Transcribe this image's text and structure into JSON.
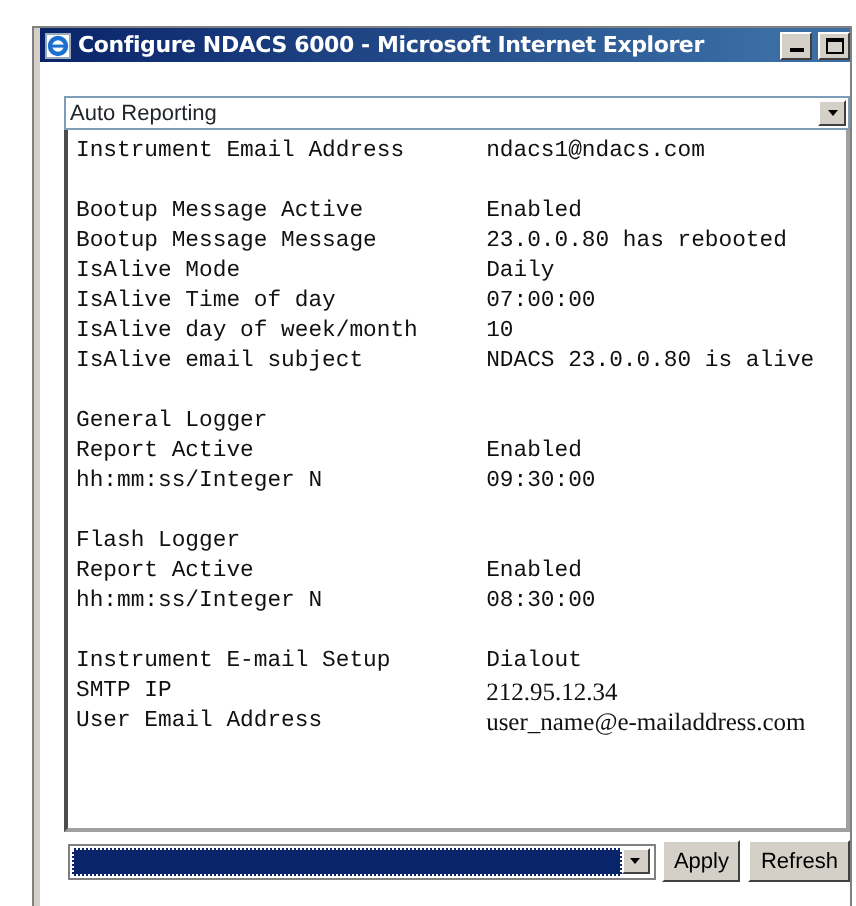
{
  "window": {
    "title": "Configure NDACS 6000 - Microsoft Internet Explorer"
  },
  "section_select": {
    "value": "Auto Reporting"
  },
  "sections": [
    {
      "rows": [
        {
          "kind": "pair",
          "label": "Instrument Email Address",
          "value": "ndacs1@ndacs.com"
        }
      ]
    },
    {
      "rows": [
        {
          "kind": "pair",
          "label": "Bootup Message Active",
          "value": "Enabled"
        },
        {
          "kind": "pair",
          "label": "Bootup Message Message",
          "value": "23.0.0.80 has rebooted"
        },
        {
          "kind": "pair",
          "label": "IsAlive Mode",
          "value": "Daily"
        },
        {
          "kind": "pair",
          "label": "IsAlive Time of day",
          "value": "07:00:00"
        },
        {
          "kind": "pair",
          "label": "IsAlive day of week/month",
          "value": "10"
        },
        {
          "kind": "pair",
          "label": "IsAlive email subject",
          "value": "NDACS 23.0.0.80 is alive"
        }
      ]
    },
    {
      "rows": [
        {
          "kind": "heading",
          "label": "General Logger"
        },
        {
          "kind": "pair",
          "label": "Report Active",
          "value": "Enabled"
        },
        {
          "kind": "pair",
          "label": "hh:mm:ss/Integer N",
          "value": "09:30:00"
        }
      ]
    },
    {
      "rows": [
        {
          "kind": "heading",
          "label": "Flash Logger"
        },
        {
          "kind": "pair",
          "label": "Report Active",
          "value": "Enabled"
        },
        {
          "kind": "pair",
          "label": "hh:mm:ss/Integer N",
          "value": "08:30:00"
        }
      ]
    },
    {
      "rows": [
        {
          "kind": "pair",
          "label": "Instrument E-mail Setup",
          "value": "Dialout"
        },
        {
          "kind": "pair-serif",
          "label": "SMTP IP",
          "value": "212.95.12.34"
        },
        {
          "kind": "pair-serif",
          "label": "User Email Address",
          "value": "user_name@e-mailaddress.com"
        }
      ]
    }
  ],
  "buttons": [
    {
      "label": "Apply"
    },
    {
      "label": "Refresh"
    }
  ]
}
